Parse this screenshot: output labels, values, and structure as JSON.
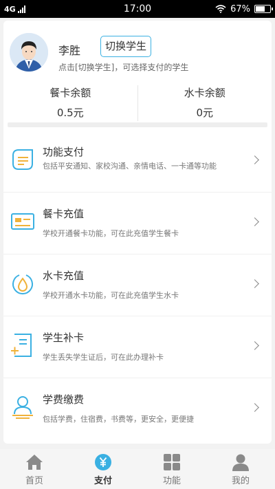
{
  "status_bar": {
    "network": "4G",
    "time": "17:00",
    "battery": "67%",
    "battery_level": 0.67
  },
  "profile": {
    "name": "李胜",
    "switch_label": "切换学生",
    "hint": "点击[切换学生]，可选择支付的学生"
  },
  "balances": [
    {
      "label": "餐卡余额",
      "value": "0.5元"
    },
    {
      "label": "水卡余额",
      "value": "0元"
    }
  ],
  "menu": [
    {
      "title": "功能支付",
      "desc": "包括平安通知、家校沟通、亲情电话、一卡通等功能",
      "icon": "document-lines-icon"
    },
    {
      "title": "餐卡充值",
      "desc": "学校开通餐卡功能，可在此充值学生餐卡",
      "icon": "card-icon"
    },
    {
      "title": "水卡充值",
      "desc": "学校开通水卡功能，可在此充值学生水卡",
      "icon": "water-drop-icon"
    },
    {
      "title": "学生补卡",
      "desc": "学生丢失学生证后，可在此办理补卡",
      "icon": "replace-card-icon"
    },
    {
      "title": "学费缴费",
      "desc": "包括学费，住宿费，书费等，更安全，更便捷",
      "icon": "person-pay-icon"
    }
  ],
  "tabs": [
    {
      "label": "首页",
      "icon": "home-icon"
    },
    {
      "label": "支付",
      "icon": "yuan-icon"
    },
    {
      "label": "功能",
      "icon": "grid-icon"
    },
    {
      "label": "我的",
      "icon": "person-icon"
    }
  ],
  "colors": {
    "accent": "#3ab0e2",
    "icon_orange": "#f0b23a",
    "tab_gray": "#8a8a8a"
  }
}
